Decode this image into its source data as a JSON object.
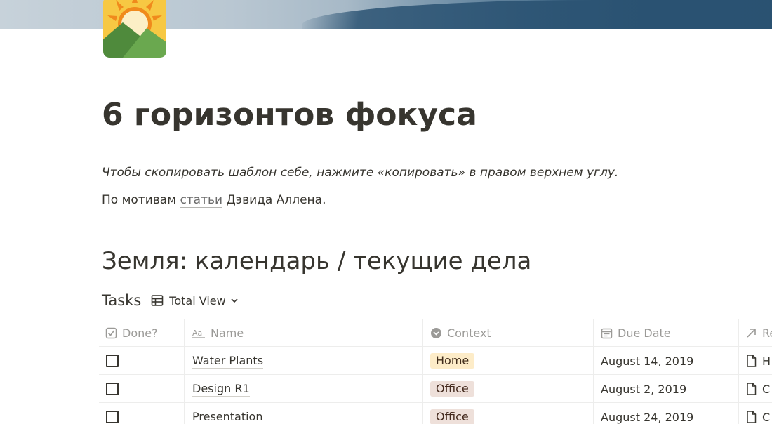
{
  "page": {
    "title": "6 горизонтов фокуса",
    "icon": "sun-over-mountains-icon",
    "note_italic": "Чтобы скопировать шаблон себе, нажмите «копировать» в правом верхнем углу.",
    "note_prefix": "По мотивам ",
    "note_link": "статьи",
    "note_suffix": " Дэвида Аллена."
  },
  "section": {
    "title": "Земля: календарь / текущие дела"
  },
  "database": {
    "title": "Tasks",
    "view_label": "Total View",
    "view_icon": "table-icon",
    "columns": [
      {
        "label": "Done?",
        "icon": "checkbox-icon"
      },
      {
        "label": "Name",
        "icon": "text-icon"
      },
      {
        "label": "Context",
        "icon": "select-icon"
      },
      {
        "label": "Due Date",
        "icon": "calendar-icon"
      },
      {
        "label": "Re",
        "icon": "relation-arrow-icon"
      }
    ],
    "rows": [
      {
        "done": false,
        "name": "Water Plants",
        "context": "Home",
        "due": "August 14, 2019",
        "related": "H"
      },
      {
        "done": false,
        "name": "Design R1",
        "context": "Office",
        "due": "August 2, 2019",
        "related": "C"
      },
      {
        "done": false,
        "name": "Presentation",
        "context": "Office",
        "due": "August 24, 2019",
        "related": "C"
      }
    ]
  },
  "colors": {
    "text": "#37352f",
    "muted": "#9b9a97",
    "tag_home": "#fdecc8",
    "tag_office": "#eee0da"
  }
}
